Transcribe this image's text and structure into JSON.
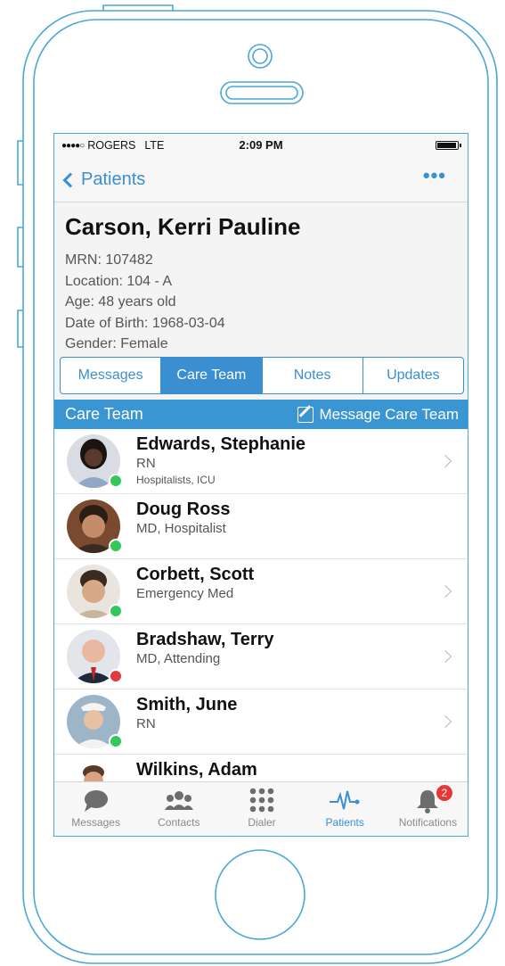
{
  "status_bar": {
    "carrier": "ROGERS",
    "network": "LTE",
    "time": "2:09 PM"
  },
  "nav": {
    "back_label": "Patients",
    "more_label": "•••"
  },
  "patient": {
    "name": "Carson, Kerri Pauline",
    "mrn": "MRN: 107482",
    "location": "Location: 104 - A",
    "age": "Age: 48 years old",
    "dob": "Date of Birth: 1968-03-04",
    "gender": "Gender: Female"
  },
  "tabs": [
    {
      "label": "Messages",
      "active": false
    },
    {
      "label": "Care Team",
      "active": true
    },
    {
      "label": "Notes",
      "active": false
    },
    {
      "label": "Updates",
      "active": false
    }
  ],
  "section": {
    "title": "Care Team",
    "action_label": "Message Care Team"
  },
  "care_team": [
    {
      "name": "Edwards, Stephanie",
      "role": "RN",
      "sub": "Hospitalists, ICU",
      "status": "online",
      "status_color": "#34c759",
      "has_chevron": true
    },
    {
      "name": "Doug Ross",
      "role": "MD, Hospitalist",
      "sub": "",
      "status": "online",
      "status_color": "#34c759",
      "has_chevron": false
    },
    {
      "name": "Corbett, Scott",
      "role": "Emergency Med",
      "sub": "",
      "status": "online",
      "status_color": "#34c759",
      "has_chevron": true
    },
    {
      "name": "Bradshaw, Terry",
      "role": "MD, Attending",
      "sub": "",
      "status": "busy",
      "status_color": "#e0393e",
      "has_chevron": true
    },
    {
      "name": "Smith, June",
      "role": "RN",
      "sub": "",
      "status": "online",
      "status_color": "#34c759",
      "has_chevron": true
    },
    {
      "name": "Wilkins, Adam",
      "role": "",
      "sub": "",
      "status": "",
      "status_color": "",
      "has_chevron": true
    }
  ],
  "tab_bar": [
    {
      "label": "Messages",
      "icon": "chat-bubble-icon",
      "active": false
    },
    {
      "label": "Contacts",
      "icon": "contacts-icon",
      "active": false
    },
    {
      "label": "Dialer",
      "icon": "dialpad-icon",
      "active": false
    },
    {
      "label": "Patients",
      "icon": "heartbeat-icon",
      "active": true
    },
    {
      "label": "Notifications",
      "icon": "bell-icon",
      "active": false,
      "badge": "2"
    }
  ],
  "colors": {
    "accent": "#3a8fd0",
    "section_bar": "#3a96d2",
    "online": "#34c759",
    "busy": "#e0393e",
    "badge": "#e53935"
  }
}
